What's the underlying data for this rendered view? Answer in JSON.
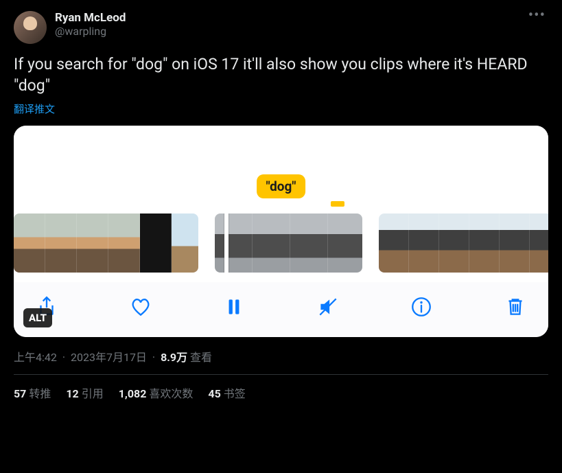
{
  "author": {
    "display_name": "Ryan McLeod",
    "handle": "@warpling"
  },
  "body_text": "If you search for \"dog\" on iOS 17 it'll also show you clips where it's HEARD \"dog\"",
  "translate_label": "翻译推文",
  "media": {
    "caption_chip": "\"dog\"",
    "alt_badge": "ALT",
    "toolbar_icons": {
      "share": "share-icon",
      "like": "heart-icon",
      "pause": "pause-icon",
      "mute": "mute-icon",
      "info": "info-icon",
      "trash": "trash-icon"
    }
  },
  "meta": {
    "time": "上午4:42",
    "date": "2023年7月17日",
    "views_value": "8.9万",
    "views_label": "查看"
  },
  "stats": {
    "retweets_value": "57",
    "retweets_label": "转推",
    "quotes_value": "12",
    "quotes_label": "引用",
    "likes_value": "1,082",
    "likes_label": "喜欢次数",
    "bookmarks_value": "45",
    "bookmarks_label": "书签"
  }
}
